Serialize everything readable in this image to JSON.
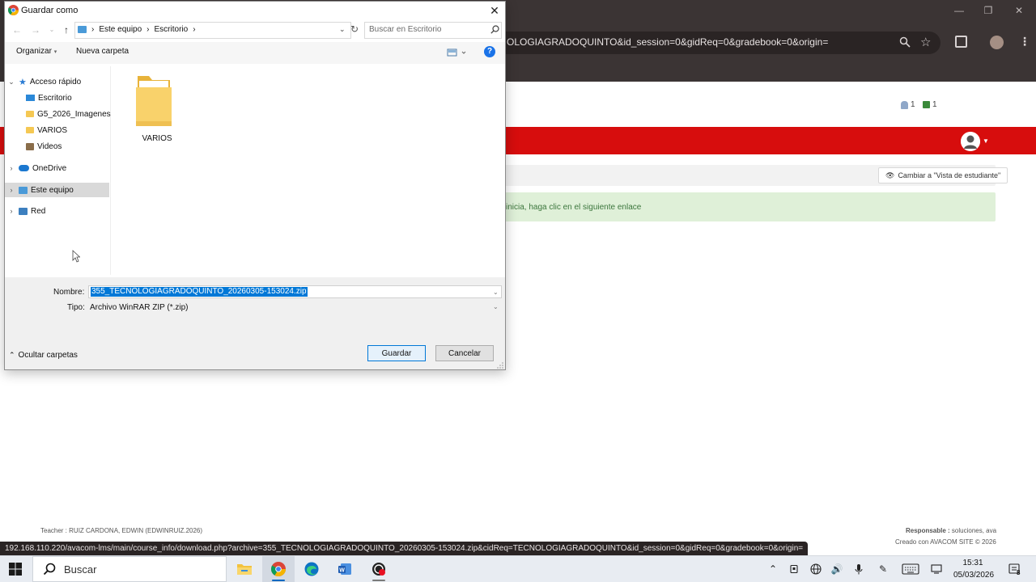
{
  "browser": {
    "address_text": "OLOGIAGRADOQUINTO&id_session=0&gidReq=0&gradebook=0&origin=",
    "status_url": "192.168.110.220/avacom-lms/main/course_info/download.php?archive=355_TECNOLOGIAGRADOQUINTO_20260305-153024.zip&cidReq=TECNOLOGIAGRADOQUINTO&id_session=0&gidReq=0&gradebook=0&origin="
  },
  "site": {
    "header_counters": [
      "1",
      "1"
    ],
    "student_view_label": "Cambiar a \"Vista de estudiante\"",
    "alert_text": "inicia, haga clic en el siguiente enlace",
    "footer_teacher_label": "Teacher :",
    "footer_teacher_value": "RUIZ CARDONA, EDWIN (EDWINRUIZ.2026)",
    "footer_responsable_label": "Responsable :",
    "footer_responsable_value": "soluciones, ava",
    "footer_created": "Creado con AVACOM SITE © 2026",
    "colors": {
      "brand_red": "#d70d0d",
      "alert_green": "#dff0d8",
      "alert_text": "#3c763d"
    }
  },
  "dialog": {
    "title": "Guardar como",
    "path": [
      "Este equipo",
      "Escritorio"
    ],
    "search_placeholder": "Buscar en Escritorio",
    "toolbar": {
      "organize": "Organizar",
      "new_folder": "Nueva carpeta"
    },
    "nav": {
      "quick_access": "Acceso rápido",
      "quick_items": [
        "Escritorio",
        "G5_2026_Imagenes",
        "VARIOS",
        "Videos"
      ],
      "onedrive": "OneDrive",
      "this_pc": "Este equipo",
      "network": "Red"
    },
    "files": [
      {
        "name": "VARIOS",
        "icon": "folder-icon"
      }
    ],
    "name_label": "Nombre:",
    "file_name": "355_TECNOLOGIAGRADOQUINTO_20260305-153024.zip",
    "type_label": "Tipo:",
    "file_type": "Archivo WinRAR ZIP (*.zip)",
    "hide_folders": "Ocultar carpetas",
    "save": "Guardar",
    "cancel": "Cancelar"
  },
  "taskbar": {
    "search_label": "Buscar",
    "apps": [
      "file-explorer-icon",
      "chrome-icon",
      "edge-icon",
      "word-icon",
      "screen-recorder-icon"
    ],
    "time": "15:31",
    "date": "05/03/2026",
    "notification_count": "8"
  }
}
